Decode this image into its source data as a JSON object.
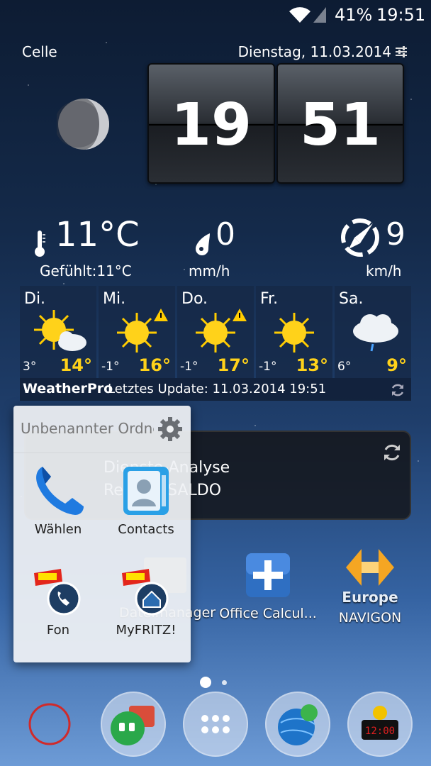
{
  "status_bar": {
    "battery": "41%",
    "time": "19:51"
  },
  "weather": {
    "city": "Celle",
    "date": "Dienstag, 11.03.2014",
    "clock_hour": "19",
    "clock_minute": "51",
    "temperature": "11°C",
    "feels_like": "Gefühlt:11°C",
    "precipitation": "0",
    "precipitation_unit": "mm/h",
    "wind_speed": "9",
    "wind_unit": "km/h",
    "forecast": [
      {
        "day": "Di.",
        "low": "3°",
        "high": "14°",
        "icon": "sun-cloud-icon"
      },
      {
        "day": "Mi.",
        "low": "-1°",
        "high": "16°",
        "icon": "sun-warning-icon"
      },
      {
        "day": "Do.",
        "low": "-1°",
        "high": "17°",
        "icon": "sun-warning-icon"
      },
      {
        "day": "Fr.",
        "low": "-1°",
        "high": "13°",
        "icon": "sun-icon"
      },
      {
        "day": "Sa.",
        "low": "6°",
        "high": "9°",
        "icon": "cloud-rain-icon"
      }
    ],
    "brand": "WeatherPro",
    "last_update": "Letztes Update: 11.03.2014 19:51"
  },
  "calendar": {
    "events": [
      {
        "text": "Dienste-Analyse"
      },
      {
        "text": "Refresh SALDO"
      }
    ]
  },
  "folder": {
    "title": "Unbenannter Ordner",
    "apps": [
      {
        "label": "Wählen"
      },
      {
        "label": "Contacts"
      },
      {
        "label": "Fon"
      },
      {
        "label": "MyFRITZ!"
      }
    ]
  },
  "desktop_apps": [
    {
      "label": "Dateimanager"
    },
    {
      "label": "Office Calcul..."
    },
    {
      "label": "NAVIGON",
      "sub": "Europe"
    }
  ],
  "colors": {
    "high_temp": "#ffd21a",
    "accent_blue": "#1a73d9"
  }
}
